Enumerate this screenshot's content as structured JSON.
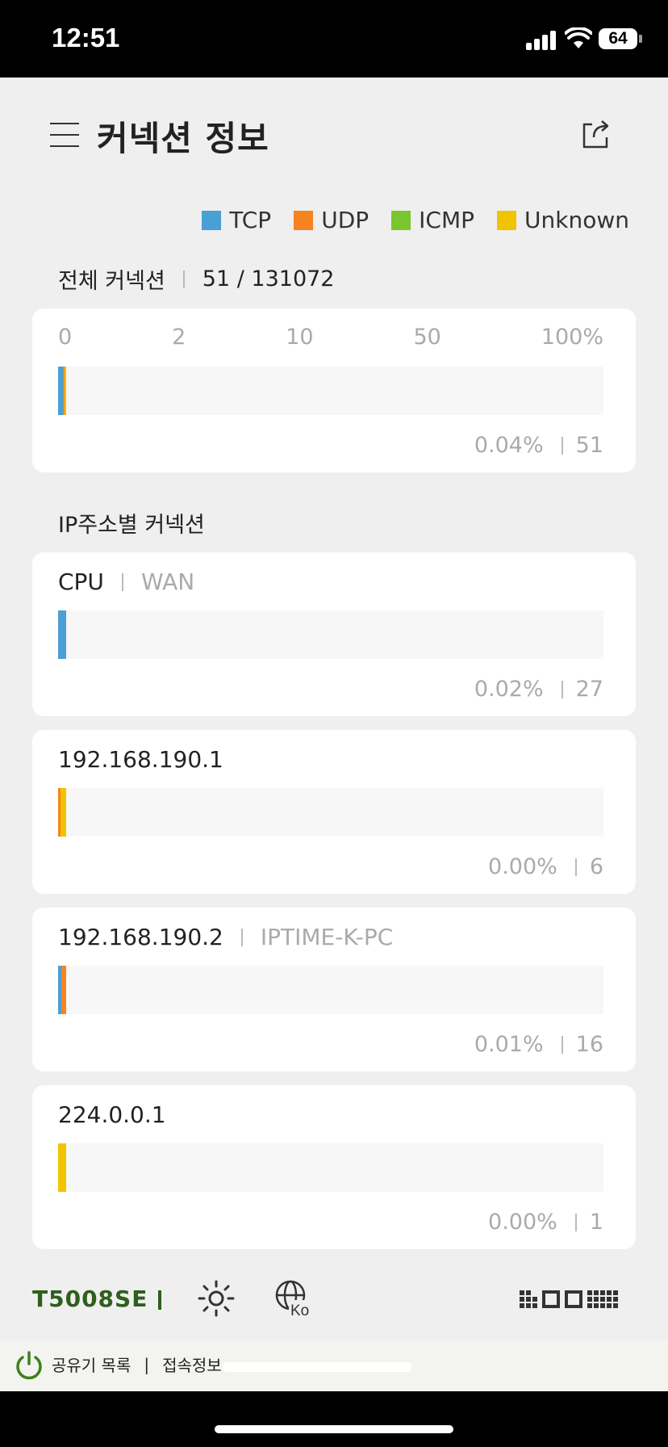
{
  "status_bar": {
    "time": "12:51",
    "battery": "64"
  },
  "header": {
    "title": "커넥션 정보"
  },
  "legend": [
    {
      "label": "TCP",
      "color": "#4a9fd4"
    },
    {
      "label": "UDP",
      "color": "#f5831f"
    },
    {
      "label": "ICMP",
      "color": "#7ac62e"
    },
    {
      "label": "Unknown",
      "color": "#f2c300"
    }
  ],
  "total": {
    "label": "전체 커넥션",
    "value": "51 / 131072",
    "scale": [
      "0",
      "2",
      "10",
      "50",
      "100%"
    ],
    "percent": "0.04%",
    "count": "51"
  },
  "by_ip": {
    "label": "IP주소별 커넥션",
    "items": [
      {
        "name": "CPU",
        "sub": "WAN",
        "percent": "0.02%",
        "count": "27"
      },
      {
        "name": "192.168.190.1",
        "sub": "",
        "percent": "0.00%",
        "count": "6"
      },
      {
        "name": "192.168.190.2",
        "sub": "IPTIME-K-PC",
        "percent": "0.01%",
        "count": "16"
      },
      {
        "name": "224.0.0.1",
        "sub": "",
        "percent": "0.00%",
        "count": "1"
      }
    ]
  },
  "bottom_bar": {
    "model": "T5008SE",
    "globe_label": "Ko"
  },
  "footer": {
    "router_list": "공유기 목록",
    "pipe": "|",
    "access_info": "접속정보 :"
  }
}
